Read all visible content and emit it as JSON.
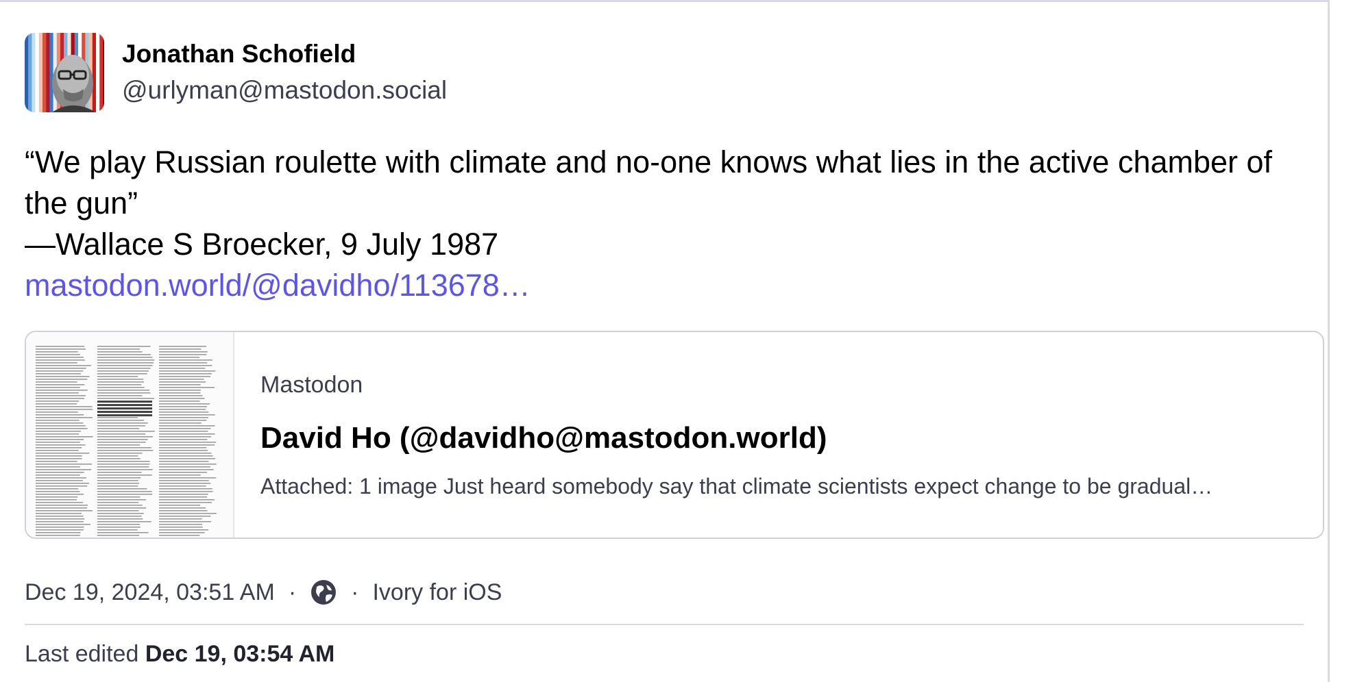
{
  "post": {
    "author": {
      "display_name": "Jonathan Schofield",
      "handle": "@urlyman@mastodon.social"
    },
    "content": {
      "quote": "“We play Russian roulette with climate and no-one knows what lies in the active chamber of the gun”",
      "attribution": "—Wallace S Broecker, 9 July 1987",
      "link": "mastodon.world/@davidho/113678…"
    },
    "card": {
      "provider": "Mastodon",
      "title": "David Ho (@davidho@mastodon.world)",
      "description": "Attached: 1 image Just heard somebody say that climate scientists expect change to be gradual…"
    },
    "meta": {
      "timestamp": "Dec 19, 2024, 03:51 AM",
      "visibility_icon": "globe-icon",
      "dot": "·",
      "application": "Ivory for iOS",
      "edited_label": "Last edited",
      "edited_time": "Dec 19, 03:54 AM"
    }
  },
  "colors": {
    "link": "#5b55e8",
    "secondary_text": "#3b3e4e",
    "border": "#d9dae3"
  }
}
